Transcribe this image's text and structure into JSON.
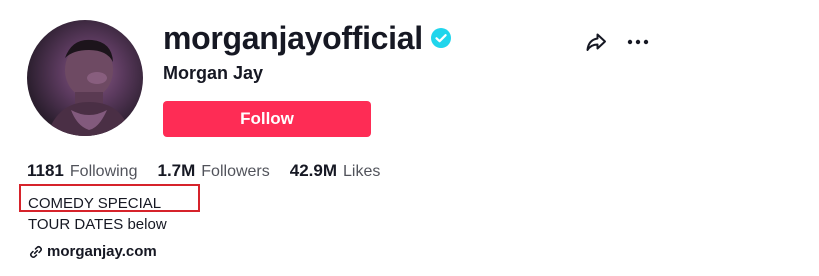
{
  "profile": {
    "username": "morganjayofficial",
    "display_name": "Morgan Jay",
    "verified": true,
    "verified_color": "#20d5ec",
    "follow_label": "Follow",
    "follow_color": "#fe2c55"
  },
  "stats": {
    "following_count": "1181",
    "following_label": "Following",
    "followers_count": "1.7M",
    "followers_label": "Followers",
    "likes_count": "42.9M",
    "likes_label": "Likes"
  },
  "bio": {
    "line1": "COMEDY SPECIAL",
    "line2": "TOUR DATES below",
    "highlight_color": "#d6232b"
  },
  "link": {
    "text": "morganjay.com",
    "icon": "link-icon"
  },
  "actions": {
    "share_icon": "share-icon",
    "more_icon": "more-icon"
  }
}
